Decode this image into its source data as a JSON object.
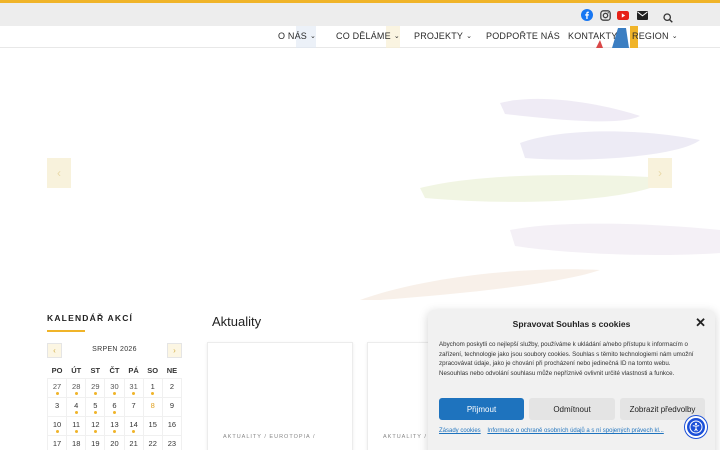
{
  "colors": {
    "accent": "#f0b429",
    "primary_button": "#1e73be",
    "facebook": "#1877f2",
    "instagram": "#444444",
    "youtube": "#e62117",
    "accessibility": "#1b4fd8"
  },
  "topbar": {
    "icons": [
      "facebook-icon",
      "instagram-icon",
      "youtube-icon",
      "mail-icon",
      "search-icon"
    ]
  },
  "nav": {
    "items": [
      {
        "label": "O NÁS",
        "has_dropdown": true
      },
      {
        "label": "CO DĚLÁME",
        "has_dropdown": true
      },
      {
        "label": "PROJEKTY",
        "has_dropdown": true
      },
      {
        "label": "PODPOŘTE NÁS",
        "has_dropdown": false
      },
      {
        "label": "KONTAKTY",
        "has_dropdown": false
      },
      {
        "label": "REGION",
        "has_dropdown": true
      }
    ]
  },
  "calendar": {
    "title": "KALENDÁŘ AKCÍ",
    "month": "SRPEN 2026",
    "weekdays": [
      "PO",
      "ÚT",
      "ST",
      "ČT",
      "PÁ",
      "SO",
      "NE"
    ],
    "weeks": [
      [
        {
          "d": "27",
          "ev": true
        },
        {
          "d": "28",
          "ev": true
        },
        {
          "d": "29",
          "ev": true
        },
        {
          "d": "30",
          "ev": true
        },
        {
          "d": "31",
          "ev": true
        },
        {
          "d": "1",
          "ev": true
        },
        {
          "d": "2",
          "ev": false
        }
      ],
      [
        {
          "d": "3",
          "ev": false
        },
        {
          "d": "4",
          "ev": true
        },
        {
          "d": "5",
          "ev": true
        },
        {
          "d": "6",
          "ev": true
        },
        {
          "d": "7",
          "ev": false
        },
        {
          "d": "8",
          "ev": false,
          "hl": true
        },
        {
          "d": "9",
          "ev": false
        }
      ],
      [
        {
          "d": "10",
          "ev": true
        },
        {
          "d": "11",
          "ev": true
        },
        {
          "d": "12",
          "ev": true
        },
        {
          "d": "13",
          "ev": true
        },
        {
          "d": "14",
          "ev": true
        },
        {
          "d": "15",
          "ev": false
        },
        {
          "d": "16",
          "ev": false
        }
      ],
      [
        {
          "d": "17",
          "ev": false
        },
        {
          "d": "18",
          "ev": false
        },
        {
          "d": "19",
          "ev": false
        },
        {
          "d": "20",
          "ev": false
        },
        {
          "d": "21",
          "ev": false
        },
        {
          "d": "22",
          "ev": false
        },
        {
          "d": "23",
          "ev": false
        }
      ]
    ]
  },
  "news": {
    "title": "Aktuality",
    "cards": [
      {
        "category": "AKTUALITY / EUROTOPIA /"
      },
      {
        "category": "AKTUALITY / EU"
      }
    ]
  },
  "cookie": {
    "title": "Spravovat Souhlas s cookies",
    "text": "Abychom poskytli co nejlepší služby, používáme k ukládání a/nebo přístupu k informacím o zařízení, technologie jako jsou soubory cookies. Souhlas s těmito technologiemi nám umožní zpracovávat údaje, jako je chování při procházení nebo jedinečná ID na tomto webu. Nesouhlas nebo odvolání souhlasu může nepříznivě ovlivnit určité vlastnosti a funkce.",
    "accept_label": "Přijmout",
    "deny_label": "Odmítnout",
    "prefs_label": "Zobrazit předvolby",
    "link_cookie_policy": "Zásady cookies",
    "link_privacy": "Informace o ochraně osobních údajů a s ní spojených právech kl..."
  }
}
